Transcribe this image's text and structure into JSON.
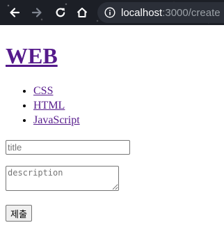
{
  "browser": {
    "url_host": "localhost",
    "url_path": ":3000/create",
    "icons": [
      "back-icon",
      "forward-icon",
      "reload-icon",
      "home-icon",
      "info-icon"
    ]
  },
  "page": {
    "heading": "WEB",
    "topics": [
      {
        "label": "CSS"
      },
      {
        "label": "HTML"
      },
      {
        "label": "JavaScript"
      }
    ],
    "form": {
      "title_placeholder": "title",
      "description_placeholder": "description",
      "submit_label": "제출"
    }
  }
}
